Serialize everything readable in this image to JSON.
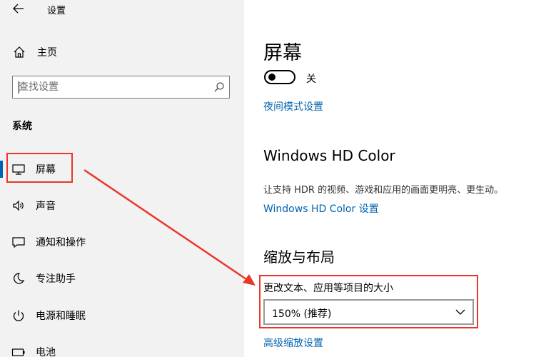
{
  "window": {
    "title": "设置"
  },
  "nav": {
    "home_label": "主页",
    "search_placeholder": "查找设置",
    "section_label": "系统",
    "items": [
      {
        "label": "屏幕",
        "icon": "monitor-icon",
        "selected": true
      },
      {
        "label": "声音",
        "icon": "speaker-icon",
        "selected": false
      },
      {
        "label": "通知和操作",
        "icon": "notification-icon",
        "selected": false
      },
      {
        "label": "专注助手",
        "icon": "moon-icon",
        "selected": false
      },
      {
        "label": "电源和睡眠",
        "icon": "power-icon",
        "selected": false
      },
      {
        "label": "电池",
        "icon": "battery-icon",
        "selected": false
      }
    ]
  },
  "content": {
    "heading": "屏幕",
    "night_light": {
      "toggle_state": "关",
      "is_on": false,
      "settings_link": "夜间模式设置"
    },
    "hdr": {
      "heading": "Windows HD Color",
      "description": "让支持 HDR 的视频、游戏和应用的画面更明亮、更生动。",
      "settings_link": "Windows HD Color 设置"
    },
    "scale_layout": {
      "heading": "缩放与布局",
      "field_label": "更改文本、应用等项目的大小",
      "selected_value": "150% (推荐)",
      "advanced_link": "高级缩放设置"
    }
  },
  "colors": {
    "accent": "#0063b1",
    "annotation": "#e8382a",
    "nav_background": "#f2f2f2"
  }
}
